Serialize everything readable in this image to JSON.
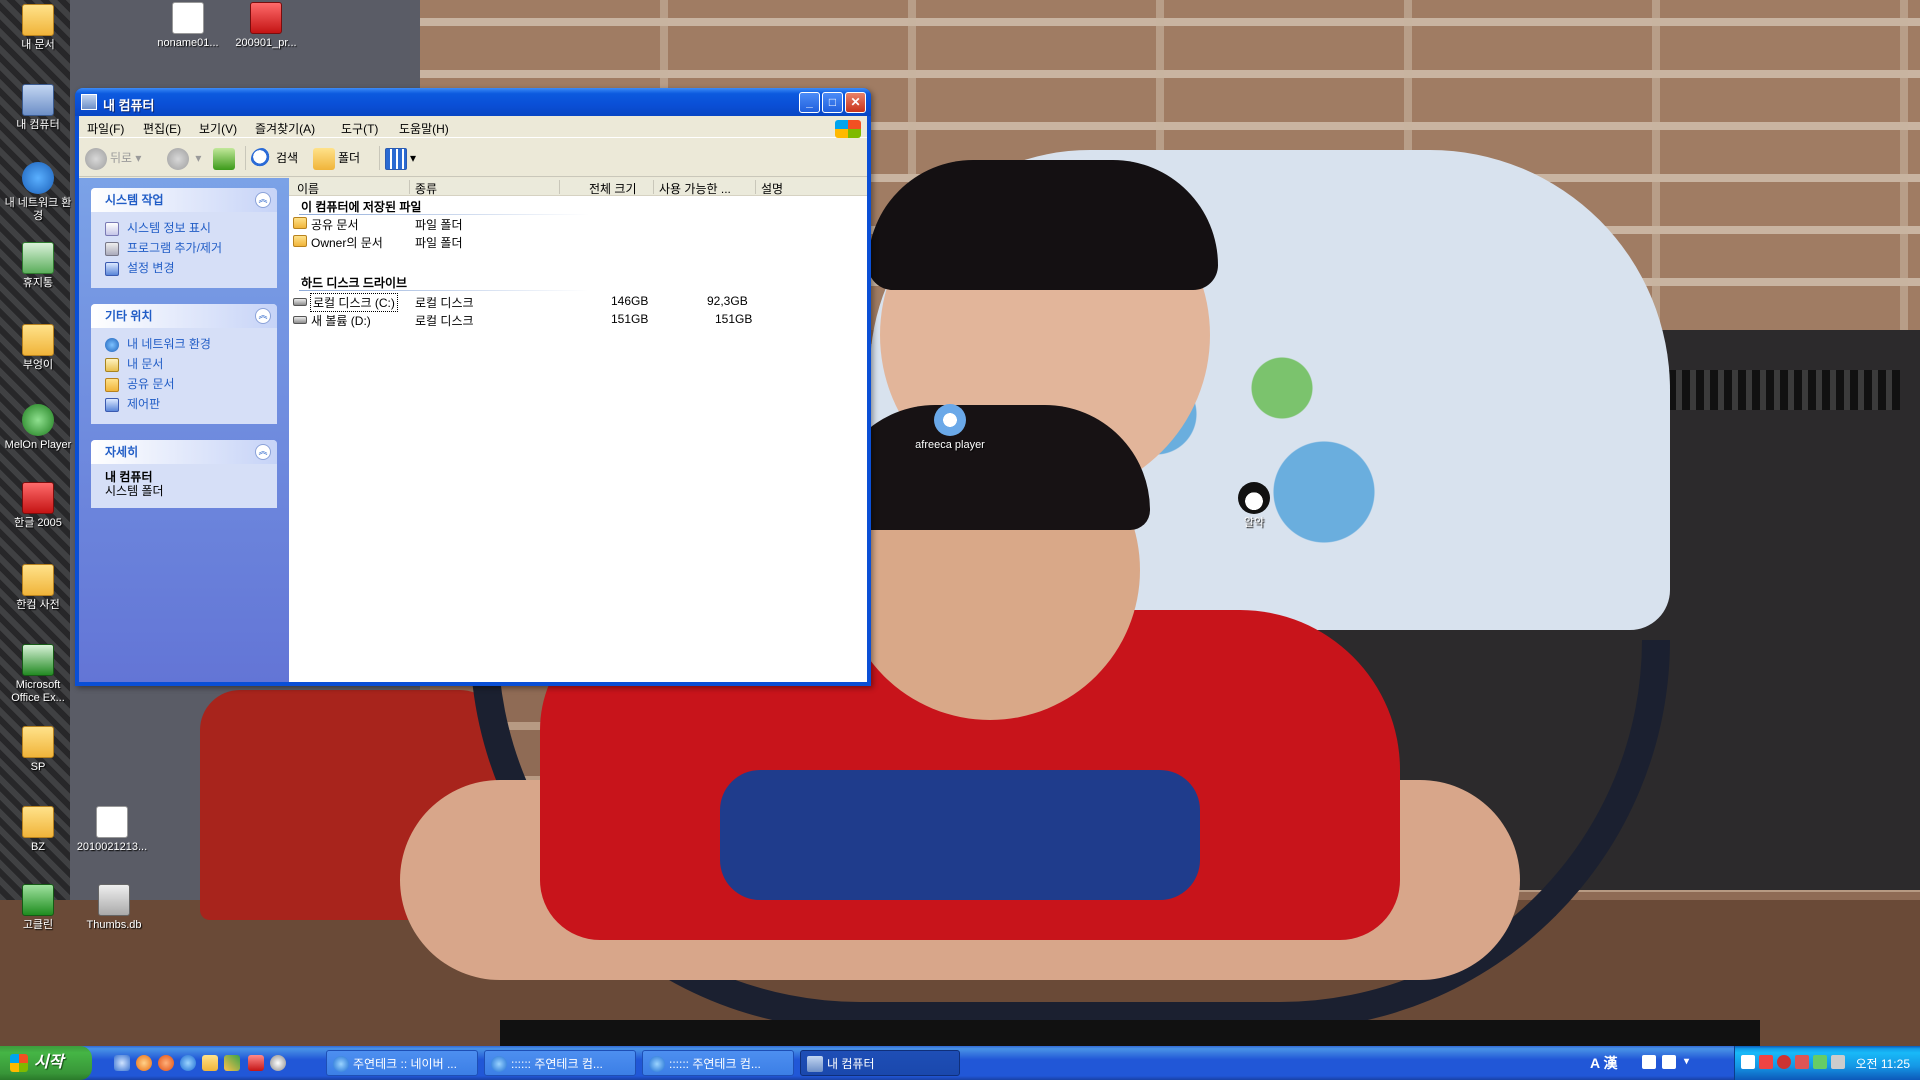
{
  "desktop": {
    "icons": [
      {
        "label": "내 문서",
        "icon": "my-documents-icon"
      },
      {
        "label": "noname01...",
        "icon": "image-file-icon"
      },
      {
        "label": "200901_pr...",
        "icon": "pdf-file-icon"
      },
      {
        "label": "내 컴퓨터",
        "icon": "my-computer-icon"
      },
      {
        "label": "내 네트워크 환경",
        "icon": "network-places-icon"
      },
      {
        "label": "휴지통",
        "icon": "recycle-bin-icon"
      },
      {
        "label": "부엉이",
        "icon": "folder-icon"
      },
      {
        "label": "MelOn Player",
        "icon": "melon-player-icon"
      },
      {
        "label": "한글 2005",
        "icon": "hangul-icon"
      },
      {
        "label": "한컴 사전",
        "icon": "hancom-dictionary-icon"
      },
      {
        "label": "Microsoft Office Ex...",
        "icon": "excel-icon"
      },
      {
        "label": "SP",
        "icon": "folder-icon"
      },
      {
        "label": "BZ",
        "icon": "folder-icon"
      },
      {
        "label": "2010021213...",
        "icon": "image-file-icon"
      },
      {
        "label": "고클린",
        "icon": "goclean-icon"
      },
      {
        "label": "Thumbs.db",
        "icon": "db-file-icon"
      },
      {
        "label": "afreeca player",
        "icon": "afreeca-icon"
      },
      {
        "label": "알약",
        "icon": "alyac-icon"
      }
    ]
  },
  "window": {
    "title": "내 컴퓨터",
    "menu": [
      "파일(F)",
      "편집(E)",
      "보기(V)",
      "즐겨찾기(A)",
      "도구(T)",
      "도움말(H)"
    ],
    "toolbar": {
      "back": "뒤로",
      "search": "검색",
      "folders": "폴더"
    },
    "left_panel": {
      "system_tasks": {
        "title": "시스템 작업",
        "items": [
          "시스템 정보 표시",
          "프로그램 추가/제거",
          "설정 변경"
        ]
      },
      "other_places": {
        "title": "기타 위치",
        "items": [
          "내 네트워크 환경",
          "내 문서",
          "공유 문서",
          "제어판"
        ]
      },
      "details": {
        "title": "자세히",
        "name": "내 컴퓨터",
        "type": "시스템 폴더"
      }
    },
    "columns": [
      "이름",
      "종류",
      "전체 크기",
      "사용 가능한 ...",
      "설명"
    ],
    "groups": [
      {
        "title": "이 컴퓨터에 저장된 파일",
        "rows": [
          {
            "name": "공유 문서",
            "type": "파일 폴더",
            "total": "",
            "free": ""
          },
          {
            "name": "Owner의 문서",
            "type": "파일 폴더",
            "total": "",
            "free": ""
          }
        ]
      },
      {
        "title": "하드 디스크 드라이브",
        "rows": [
          {
            "name": "로컬 디스크 (C:)",
            "type": "로컬 디스크",
            "total": "146GB",
            "free": "92,3GB"
          },
          {
            "name": "새 볼륨 (D:)",
            "type": "로컬 디스크",
            "total": "151GB",
            "free": "151GB"
          }
        ]
      }
    ]
  },
  "taskbar": {
    "start": "시작",
    "tasks": [
      {
        "label": "주연테크 :: 네이버 ...",
        "active": false
      },
      {
        "label": ":::::: 주연테크 컴...",
        "active": false
      },
      {
        "label": ":::::: 주연테크 컴...",
        "active": false
      },
      {
        "label": "내 컴퓨터",
        "active": true
      }
    ],
    "langbar": "A 漢",
    "clock": "오전 11:25"
  }
}
